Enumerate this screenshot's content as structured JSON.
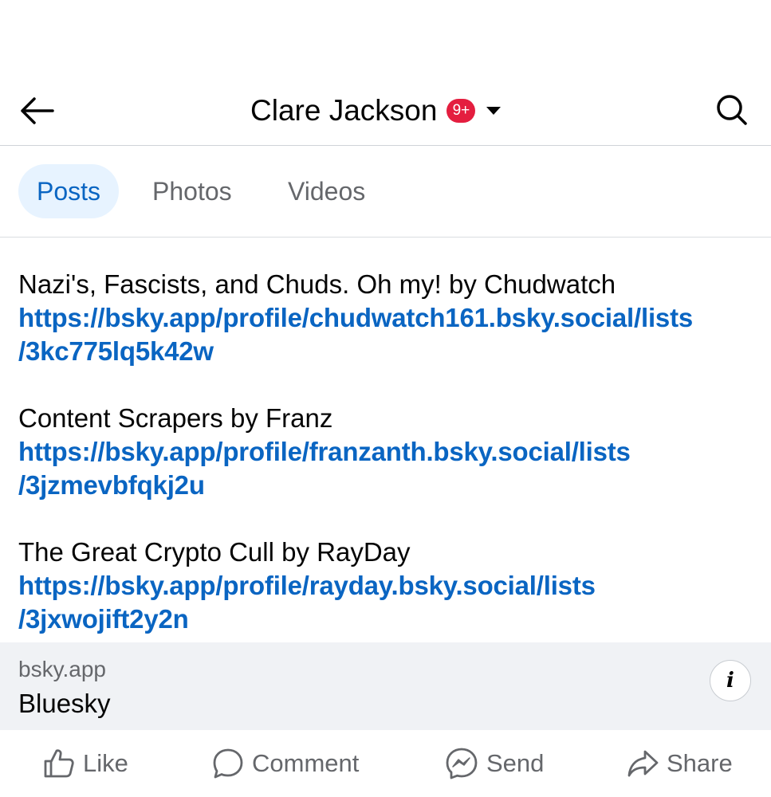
{
  "header": {
    "title": "Clare Jackson",
    "badge": "9+",
    "back_icon": "arrow-left-icon",
    "search_icon": "search-icon",
    "dropdown_icon": "caret-down-icon"
  },
  "tabs": [
    {
      "label": "Posts",
      "active": true
    },
    {
      "label": "Photos",
      "active": false
    },
    {
      "label": "Videos",
      "active": false
    }
  ],
  "post": {
    "entries": [
      {
        "title": "Nazi's, Fascists, and Chuds. Oh my! by Chudwatch",
        "link_line1": "https://bsky.app/profile/chudwatch161.bsky.social/lists",
        "link_line2": "/3kc775lq5k42w"
      },
      {
        "title": "Content Scrapers by Franz",
        "link_line1": "https://bsky.app/profile/franzanth.bsky.social/lists",
        "link_line2": "/3jzmevbfqkj2u"
      },
      {
        "title": "The Great Crypto Cull by RayDay",
        "link_line1": "https://bsky.app/profile/rayday.bsky.social/lists",
        "link_line2": "/3jxwojift2y2n"
      }
    ]
  },
  "link_preview": {
    "domain": "bsky.app",
    "title": "Bluesky",
    "info_icon": "info-icon"
  },
  "actions": [
    {
      "label": "Like",
      "icon": "thumbs-up-icon"
    },
    {
      "label": "Comment",
      "icon": "comment-icon"
    },
    {
      "label": "Send",
      "icon": "messenger-icon"
    },
    {
      "label": "Share",
      "icon": "share-icon"
    }
  ],
  "colors": {
    "accent": "#0a65c2",
    "active_tab_bg": "#e7f3ff",
    "badge": "#e41e3f",
    "preview_bg": "#f0f2f5",
    "secondary_text": "#65676b"
  }
}
